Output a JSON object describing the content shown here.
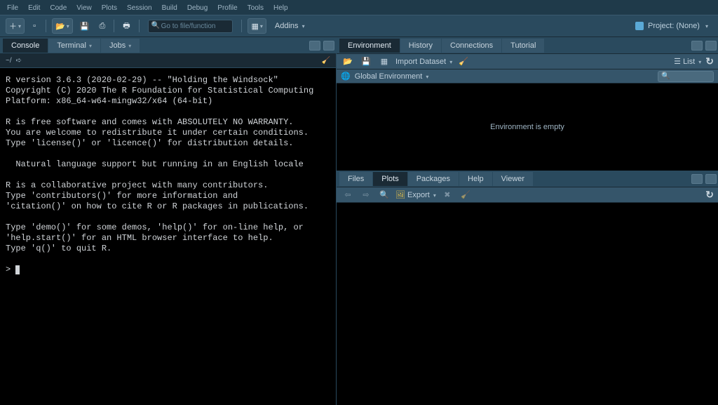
{
  "menu": [
    "File",
    "Edit",
    "Code",
    "View",
    "Plots",
    "Session",
    "Build",
    "Debug",
    "Profile",
    "Tools",
    "Help"
  ],
  "toolbar": {
    "filefunc_placeholder": "Go to file/function",
    "addins_label": "Addins",
    "project_label": "Project: (None)"
  },
  "left": {
    "tabs": [
      "Console",
      "Terminal",
      "Jobs"
    ],
    "active_tab": 0,
    "path": "~/",
    "console_text": "R version 3.6.3 (2020-02-29) -- \"Holding the Windsock\"\nCopyright (C) 2020 The R Foundation for Statistical Computing\nPlatform: x86_64-w64-mingw32/x64 (64-bit)\n\nR is free software and comes with ABSOLUTELY NO WARRANTY.\nYou are welcome to redistribute it under certain conditions.\nType 'license()' or 'licence()' for distribution details.\n\n  Natural language support but running in an English locale\n\nR is a collaborative project with many contributors.\nType 'contributors()' for more information and\n'citation()' on how to cite R or R packages in publications.\n\nType 'demo()' for some demos, 'help()' for on-line help, or\n'help.start()' for an HTML browser interface to help.\nType 'q()' to quit R.\n\n> "
  },
  "right_top": {
    "tabs": [
      "Environment",
      "History",
      "Connections",
      "Tutorial"
    ],
    "active_tab": 0,
    "import_label": "Import Dataset",
    "list_label": "List",
    "scope_label": "Global Environment",
    "empty_text": "Environment is empty"
  },
  "right_bottom": {
    "tabs": [
      "Files",
      "Plots",
      "Packages",
      "Help",
      "Viewer"
    ],
    "active_tab": 1,
    "export_label": "Export"
  }
}
